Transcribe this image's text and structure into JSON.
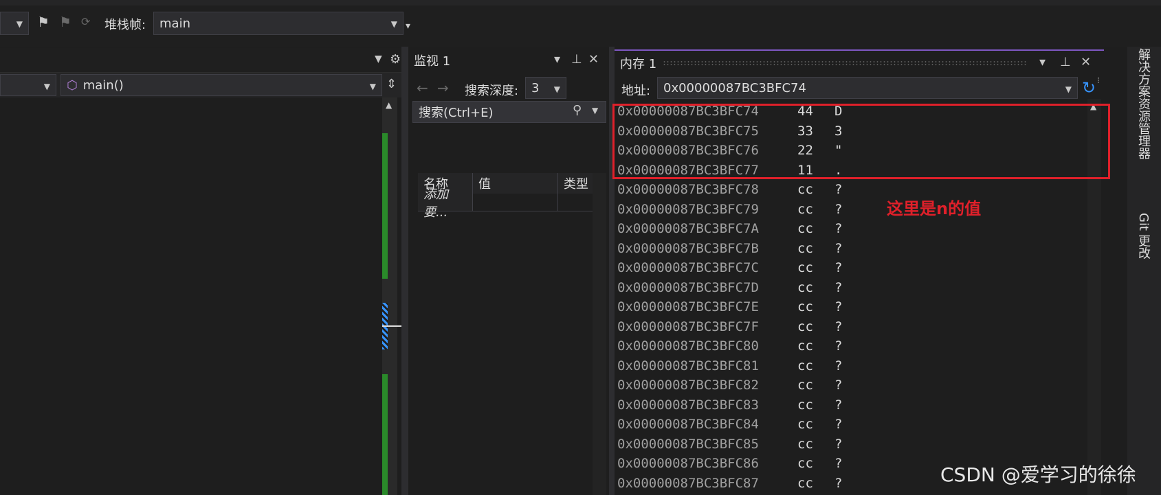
{
  "toolbar": {
    "stack_frame_label": "堆栈帧:",
    "stack_frame_value": "main"
  },
  "editor": {
    "function_dropdown": "main()"
  },
  "watch": {
    "title": "监视 1",
    "search_depth_label": "搜索深度:",
    "search_depth_value": "3",
    "search_placeholder": "搜索(Ctrl+E)",
    "columns": [
      "名称",
      "值",
      "类型"
    ],
    "add_item": "添加要..."
  },
  "memory": {
    "title": "内存 1",
    "address_label": "地址:",
    "address_value": "0x00000087BC3BFC74",
    "rows": [
      {
        "addr": "0x00000087BC3BFC74",
        "val": "44",
        "ch": "D"
      },
      {
        "addr": "0x00000087BC3BFC75",
        "val": "33",
        "ch": "3"
      },
      {
        "addr": "0x00000087BC3BFC76",
        "val": "22",
        "ch": "\""
      },
      {
        "addr": "0x00000087BC3BFC77",
        "val": "11",
        "ch": "."
      },
      {
        "addr": "0x00000087BC3BFC78",
        "val": "cc",
        "ch": "?"
      },
      {
        "addr": "0x00000087BC3BFC79",
        "val": "cc",
        "ch": "?"
      },
      {
        "addr": "0x00000087BC3BFC7A",
        "val": "cc",
        "ch": "?"
      },
      {
        "addr": "0x00000087BC3BFC7B",
        "val": "cc",
        "ch": "?"
      },
      {
        "addr": "0x00000087BC3BFC7C",
        "val": "cc",
        "ch": "?"
      },
      {
        "addr": "0x00000087BC3BFC7D",
        "val": "cc",
        "ch": "?"
      },
      {
        "addr": "0x00000087BC3BFC7E",
        "val": "cc",
        "ch": "?"
      },
      {
        "addr": "0x00000087BC3BFC7F",
        "val": "cc",
        "ch": "?"
      },
      {
        "addr": "0x00000087BC3BFC80",
        "val": "cc",
        "ch": "?"
      },
      {
        "addr": "0x00000087BC3BFC81",
        "val": "cc",
        "ch": "?"
      },
      {
        "addr": "0x00000087BC3BFC82",
        "val": "cc",
        "ch": "?"
      },
      {
        "addr": "0x00000087BC3BFC83",
        "val": "cc",
        "ch": "?"
      },
      {
        "addr": "0x00000087BC3BFC84",
        "val": "cc",
        "ch": "?"
      },
      {
        "addr": "0x00000087BC3BFC85",
        "val": "cc",
        "ch": "?"
      },
      {
        "addr": "0x00000087BC3BFC86",
        "val": "cc",
        "ch": "?"
      },
      {
        "addr": "0x00000087BC3BFC87",
        "val": "cc",
        "ch": "?"
      }
    ],
    "annotation": "这里是n的值"
  },
  "side_tabs": {
    "solution_explorer": "解决方案资源管理器",
    "git_changes": "Git 更改"
  },
  "watermark": "CSDN @爱学习的徐徐",
  "colors": {
    "annotation_red": "#e0202a",
    "active_tab_accent": "#7e57c2",
    "change_marker_green": "#2a8a2a",
    "refresh_blue": "#3794ff"
  }
}
